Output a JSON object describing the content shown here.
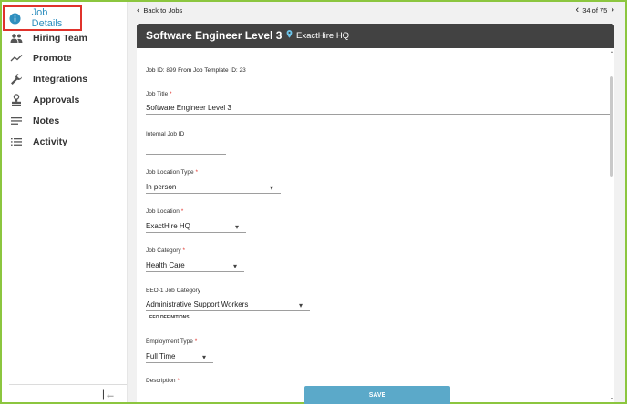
{
  "sidebar": {
    "items": [
      {
        "label": "Job Details",
        "icon": "info-icon"
      },
      {
        "label": "Hiring Team",
        "icon": "people-icon"
      },
      {
        "label": "Promote",
        "icon": "trend-icon"
      },
      {
        "label": "Integrations",
        "icon": "wrench-icon"
      },
      {
        "label": "Approvals",
        "icon": "stamp-icon"
      },
      {
        "label": "Notes",
        "icon": "notes-icon"
      },
      {
        "label": "Activity",
        "icon": "list-icon"
      }
    ],
    "collapse_glyph": "|←"
  },
  "topbar": {
    "back_label": "Back to Jobs",
    "pager": "34 of 75"
  },
  "header": {
    "title": "Software Engineer Level 3",
    "location": "ExactHire HQ"
  },
  "ids": {
    "job_id_label": "Job ID:",
    "job_id": "899",
    "template_label": "From Job Template ID:",
    "template_id": "23"
  },
  "form": {
    "job_title": {
      "label": "Job Title",
      "value": "Software Engineer Level 3"
    },
    "internal_job_id": {
      "label": "Internal Job ID",
      "value": ""
    },
    "job_location_type": {
      "label": "Job Location Type",
      "value": "In person"
    },
    "job_location": {
      "label": "Job Location",
      "value": "ExactHire HQ"
    },
    "job_category": {
      "label": "Job Category",
      "value": "Health Care"
    },
    "eeo_category": {
      "label": "EEO-1 Job Category",
      "value": "Administrative Support Workers",
      "link": "EEO DEFINITIONS"
    },
    "employment_type": {
      "label": "Employment Type",
      "value": "Full Time"
    },
    "description": {
      "label": "Description"
    }
  },
  "save_label": "SAVE",
  "colors": {
    "accent": "#2f8fbf",
    "header_bg": "#424242",
    "save_bg": "#5ba9c9",
    "frame": "#8cc63f",
    "highlight": "#e0322b"
  }
}
